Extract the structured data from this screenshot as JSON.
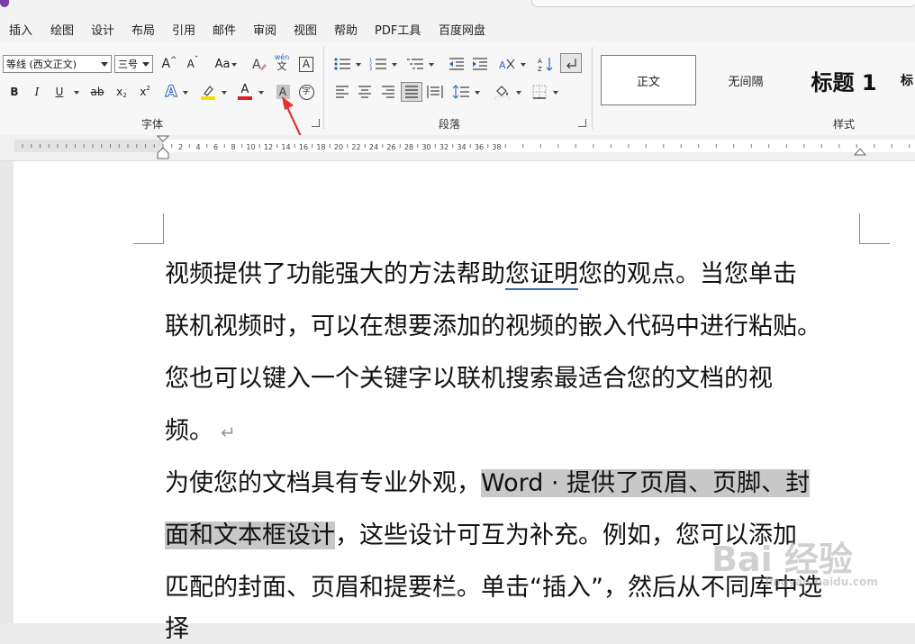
{
  "menu": {
    "items": [
      "插入",
      "绘图",
      "设计",
      "布局",
      "引用",
      "邮件",
      "审阅",
      "视图",
      "帮助",
      "PDF工具",
      "百度网盘"
    ]
  },
  "ribbon": {
    "font": {
      "font_name": "等线 (西文正文)",
      "font_size": "三号",
      "grow_label": "A",
      "shrink_label": "A",
      "case_label": "Aa",
      "wen_label": "wén",
      "wen_char": "文",
      "boxed_label": "A",
      "bold": "B",
      "italic": "I",
      "underline": "U",
      "strike": "ab",
      "sub": "x",
      "sup": "x",
      "effects": "A",
      "font_color": "A",
      "shading": "A",
      "enclose": "字",
      "group_label": "字体"
    },
    "paragraph": {
      "group_label": "段落"
    },
    "styles": {
      "group_label": "样式",
      "items": [
        "正文",
        "无间隔",
        "标题 1",
        "标"
      ]
    },
    "colors": {
      "highlight": "#f5e100",
      "font_color": "#e02020",
      "arrow": "#e2322b"
    }
  },
  "ruler": {
    "numbers": [
      "2",
      "4",
      "6",
      "8",
      "10",
      "12",
      "14",
      "16",
      "18",
      "20",
      "22",
      "24",
      "26",
      "28",
      "30",
      "32",
      "34",
      "36",
      "38"
    ]
  },
  "document": {
    "lines": [
      {
        "pre": "视频提供了功能强大的方法帮助",
        "ul": "您证明",
        "post": "您的观点。当您单击"
      },
      {
        "text": "联机视频时，可以在想要添加的视频的嵌入代码中进行粘贴。"
      },
      {
        "text": "您也可以键入一个关键字以联机搜索最适合您的文档的视"
      },
      {
        "text": "频。",
        "mark": "↵"
      },
      {
        "pre": "为使您的文档具有专业外观，",
        "hl": "Word · 提供了页眉、页脚、封"
      },
      {
        "hl": "面和文本框设计",
        "post": "，这些设计可互为补充。例如，您可以添加"
      },
      {
        "text": "匹配的封面、页眉和提要栏。单击“插入”，然后从不同库中选"
      },
      {
        "text": "择"
      }
    ]
  },
  "watermark": {
    "text": "Bai 经验",
    "sub": "jingyan.baidu.com"
  }
}
